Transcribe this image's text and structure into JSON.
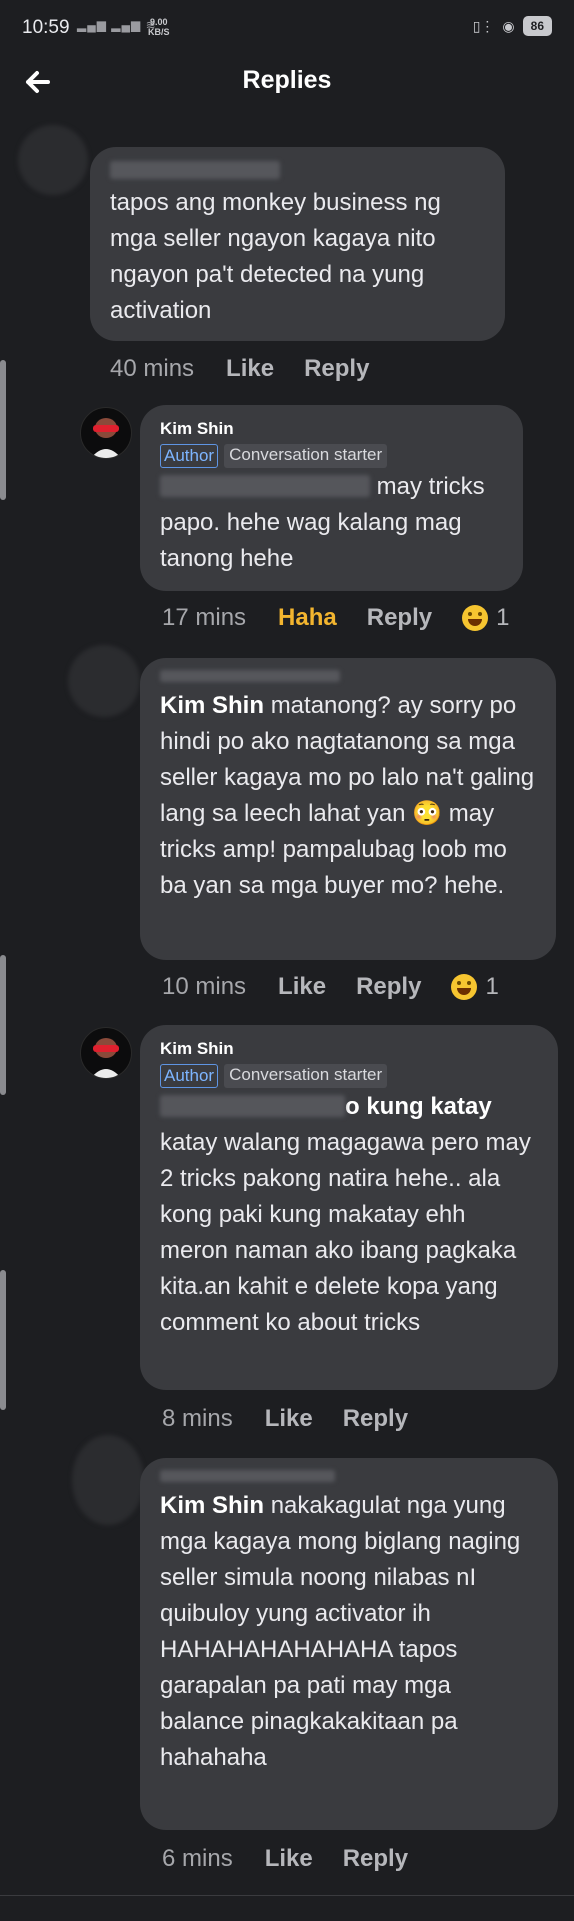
{
  "status": {
    "time": "10:59",
    "speed_value": "9.00",
    "speed_unit": "KB/S",
    "battery": "86"
  },
  "header": {
    "title": "Replies"
  },
  "comments": [
    {
      "name": "",
      "text": "tapos ang monkey business ng mga seller ngayon kagaya nito ngayon pa't detected na yung activation",
      "time": "40 mins",
      "like": "Like",
      "reply": "Reply"
    },
    {
      "name": "Kim Shin",
      "author_badge": "Author",
      "starter_badge": "Conversation starter",
      "text": "may tricks papo.  hehe wag kalang mag tanong hehe",
      "time": "17 mins",
      "reaction_label": "Haha",
      "reply": "Reply",
      "reaction_count": "1"
    },
    {
      "mention": "Kim Shin",
      "text": "matanong? ay sorry po hindi po ako nagtatanong sa mga seller kagaya mo po lalo na't galing lang sa leech lahat yan 😳 may tricks amp! pampalubag loob mo ba yan sa mga buyer mo? hehe.",
      "time": "10 mins",
      "like": "Like",
      "reply": "Reply",
      "reaction_count": "1"
    },
    {
      "name": "Kim Shin",
      "author_badge": "Author",
      "starter_badge": "Conversation starter",
      "text_suffix": "o kung katay",
      "text": "katay walang magagawa pero may 2 tricks pakong natira hehe.. ala kong paki kung makatay ehh meron naman ako ibang pagkaka kita.an kahit e delete kopa yang comment ko about tricks",
      "time": "8 mins",
      "like": "Like",
      "reply": "Reply"
    },
    {
      "mention": "Kim Shin",
      "text": "nakakagulat nga yung mga kagaya mong biglang naging seller simula noong nilabas nI quibuloy yung activator ih HAHAHAHAHAHAHA tapos garapalan pa pati may mga balance pinagkakakitaan pa hahahaha",
      "time": "6 mins",
      "like": "Like",
      "reply": "Reply"
    }
  ],
  "colors": {
    "background": "#1d1e21",
    "bubble": "#3a3b3f",
    "author_badge": "#7db5ff",
    "haha": "#f3b52f"
  },
  "icons": [
    "back-arrow-icon",
    "signal-icon",
    "wifi-icon",
    "vibrate-icon",
    "lock-icon",
    "battery-icon",
    "haha-emoji-icon"
  ]
}
